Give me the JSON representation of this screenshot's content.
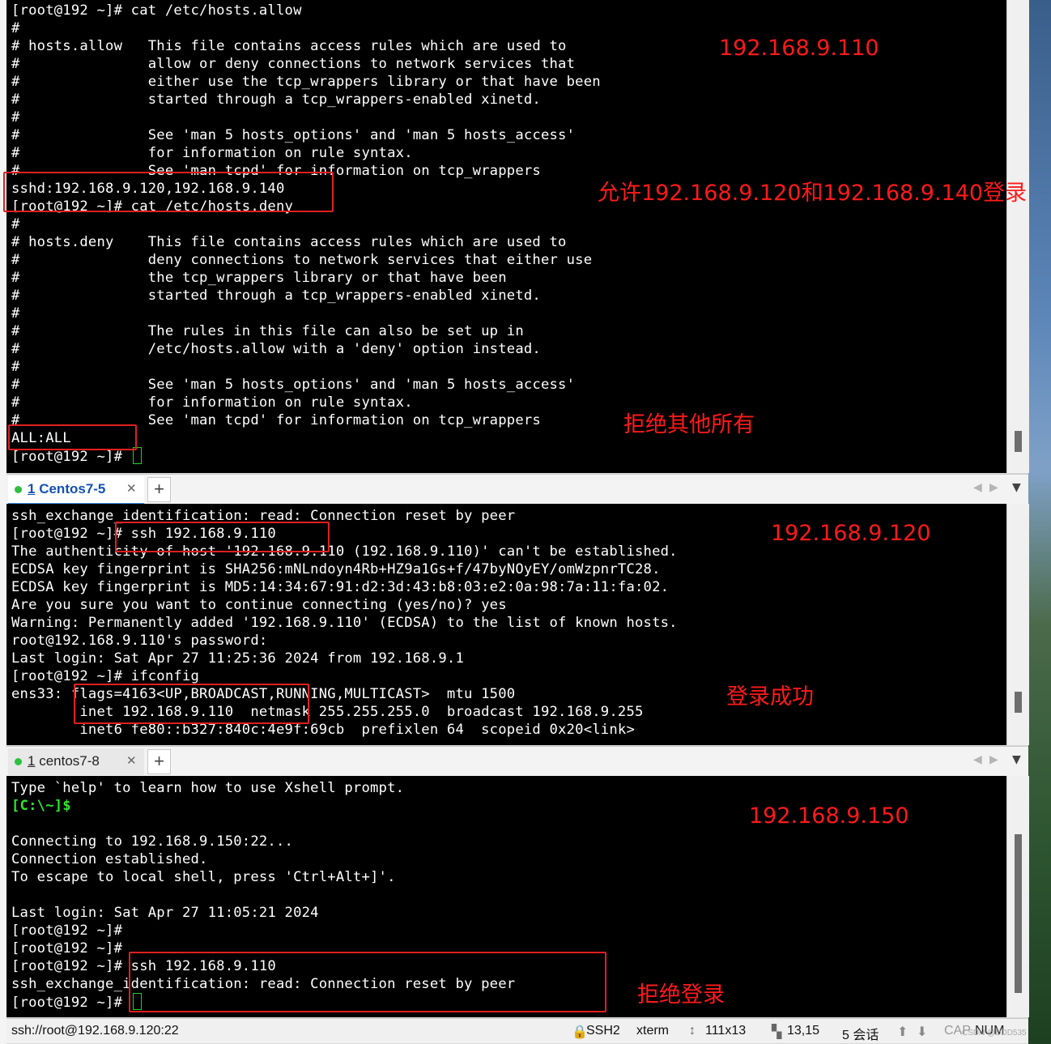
{
  "pane1": {
    "lines": [
      "[root@192 ~]# cat /etc/hosts.allow",
      "#",
      "# hosts.allow   This file contains access rules which are used to",
      "#               allow or deny connections to network services that",
      "#               either use the tcp_wrappers library or that have been",
      "#               started through a tcp_wrappers-enabled xinetd.",
      "#",
      "#               See 'man 5 hosts_options' and 'man 5 hosts_access'",
      "#               for information on rule syntax.",
      "#               See 'man tcpd' for information on tcp_wrappers",
      "sshd:192.168.9.120,192.168.9.140",
      "[root@192 ~]# cat /etc/hosts.deny",
      "#",
      "# hosts.deny    This file contains access rules which are used to",
      "#               deny connections to network services that either use",
      "#               the tcp_wrappers library or that have been",
      "#               started through a tcp_wrappers-enabled xinetd.",
      "#",
      "#               The rules in this file can also be set up in",
      "#               /etc/hosts.allow with a 'deny' option instead.",
      "#",
      "#               See 'man 5 hosts_options' and 'man 5 hosts_access'",
      "#               for information on rule syntax.",
      "#               See 'man tcpd' for information on tcp_wrappers",
      "ALL:ALL",
      "[root@192 ~]# "
    ],
    "annotations": {
      "ip": "192.168.9.110",
      "allow_note": "允许192.168.9.120和192.168.9.140登录",
      "deny_note": "拒绝其他所有"
    }
  },
  "tab2": {
    "number": "1",
    "label": "Centos7-5",
    "close": "✕"
  },
  "pane2": {
    "lines": [
      "ssh_exchange_identification: read: Connection reset by peer",
      "[root@192 ~]# ssh 192.168.9.110",
      "The authenticity of host '192.168.9.110 (192.168.9.110)' can't be established.",
      "ECDSA key fingerprint is SHA256:mNLndoyn4Rb+HZ9a1Gs+f/47byNOyEY/omWzpnrTC28.",
      "ECDSA key fingerprint is MD5:14:34:67:91:d2:3d:43:b8:03:e2:0a:98:7a:11:fa:02.",
      "Are you sure you want to continue connecting (yes/no)? yes",
      "Warning: Permanently added '192.168.9.110' (ECDSA) to the list of known hosts.",
      "root@192.168.9.110's password:",
      "Last login: Sat Apr 27 11:25:36 2024 from 192.168.9.1",
      "[root@192 ~]# ifconfig",
      "ens33: flags=4163<UP,BROADCAST,RUNNING,MULTICAST>  mtu 1500",
      "        inet 192.168.9.110  netmask 255.255.255.0  broadcast 192.168.9.255",
      "        inet6 fe80::b327:840c:4e9f:69cb  prefixlen 64  scopeid 0x20<link>"
    ],
    "annotations": {
      "ip": "192.168.9.120",
      "success_note": "登录成功"
    }
  },
  "tab3": {
    "number": "1",
    "label": "centos7-8",
    "close": "✕"
  },
  "pane3": {
    "line_help": "Type `help' to learn how to use Xshell prompt.",
    "local_prompt": "[C:\\~]$",
    "lines_after": [
      "",
      "Connecting to 192.168.9.150:22...",
      "Connection established.",
      "To escape to local shell, press 'Ctrl+Alt+]'.",
      "",
      "Last login: Sat Apr 27 11:05:21 2024",
      "[root@192 ~]#",
      "[root@192 ~]#",
      "[root@192 ~]# ssh 192.168.9.110",
      "ssh_exchange_identification: read: Connection reset by peer",
      "[root@192 ~]# "
    ],
    "annotations": {
      "ip": "192.168.9.150",
      "deny_note": "拒绝登录"
    }
  },
  "statusbar": {
    "connection": "ssh://root@192.168.9.120:22",
    "protocol": "SSH2",
    "term": "xterm",
    "size": "111x13",
    "cursor_pos": "13,15",
    "sessions": "5 会话",
    "caps": "CAP",
    "num": "NUM",
    "watermark": "CSDN @DDD535"
  },
  "colors": {
    "annotation_red": "#ff1a1a",
    "terminal_bg": "#000000",
    "prompt_green": "#2ee62e",
    "tab_accent": "#3a8ee6"
  }
}
